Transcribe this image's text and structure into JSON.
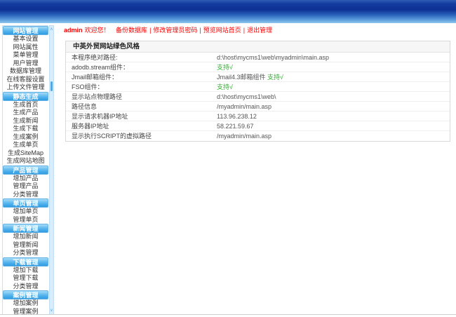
{
  "topbar": {
    "username": "admin",
    "welcome_text": "欢迎您！",
    "separator": "|",
    "links": [
      "备份数据库",
      "修改管理员密码",
      "预览网站首页",
      "退出管理"
    ]
  },
  "sidebar": {
    "scroll_up_icon": "∧",
    "scroll_down_icon": "∨",
    "sections": [
      {
        "title": "网站管理",
        "items": [
          "基本设置",
          "网站属性",
          "菜单管理",
          "用户管理",
          "数据库管理",
          "在线客服设置",
          "上传文件管理"
        ]
      },
      {
        "title": "静态生成",
        "items": [
          "生成首页",
          "生成产品",
          "生成新闻",
          "生成下载",
          "生成案例",
          "生成单页",
          "生成SiteMap",
          "生成网站地图"
        ]
      },
      {
        "title": "产品管理",
        "items": [
          "增加产品",
          "管理产品",
          "分类管理"
        ]
      },
      {
        "title": "单页管理",
        "items": [
          "增加单页",
          "管理单页"
        ]
      },
      {
        "title": "新闻管理",
        "items": [
          "增加新闻",
          "管理新闻",
          "分类管理"
        ]
      },
      {
        "title": "下载管理",
        "items": [
          "增加下载",
          "管理下载",
          "分类管理"
        ]
      },
      {
        "title": "案例管理",
        "items": [
          "增加案例",
          "管理案例"
        ]
      }
    ]
  },
  "main": {
    "panel_title": "中英外贸网站绿色风格",
    "info_rows": [
      {
        "label": "本程序绝对路径:",
        "value": "d:\\host\\mycms1\\web\\myadmin\\main.asp",
        "support": ""
      },
      {
        "label": "adodb.stream组件：",
        "value": "",
        "support": "支持√"
      },
      {
        "label": "Jmail邮箱组件：",
        "value": "Jmail4.3邮箱组件 ",
        "support": "支持√"
      },
      {
        "label": "FSO组件：",
        "value": "",
        "support": "支持√"
      },
      {
        "label": "显示站点物理路径",
        "value": "d:\\host\\mycms1\\web\\",
        "support": ""
      },
      {
        "label": "路径信息",
        "value": "/myadmin/main.asp",
        "support": ""
      },
      {
        "label": "显示请求机器IP地址",
        "value": "113.96.238.12",
        "support": ""
      },
      {
        "label": "服务器IP地址",
        "value": "58.221.59.67",
        "support": ""
      },
      {
        "label": "显示执行SCRIPT的虚拟路径",
        "value": "/myadmin/main.asp",
        "support": ""
      }
    ]
  },
  "colors": {
    "link_red": "#ff0000",
    "support_green": "#2fae2f",
    "menu_header_top": "#a6dbf8",
    "menu_header_bottom": "#2f9ce2",
    "banner_dark_blue": "#0d3094",
    "banner_light_blue": "#8ec7ee"
  }
}
